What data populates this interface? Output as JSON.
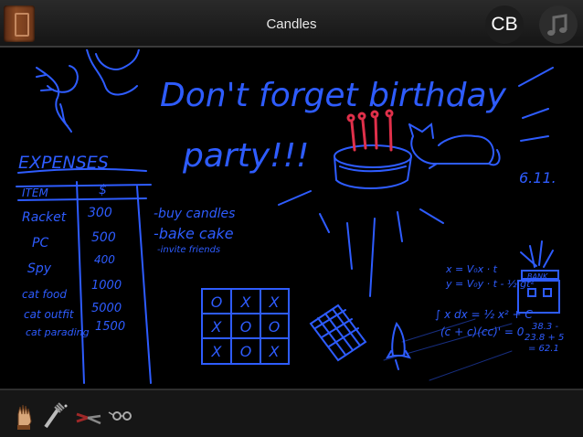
{
  "header": {
    "title": "Candles",
    "profile_initials": "CB"
  },
  "board": {
    "reminder_line1": "Don't forget birthday",
    "reminder_line2": "party!!!",
    "date": "6.11.",
    "todo": [
      "-buy candles",
      "-bake cake",
      "-invite friends"
    ],
    "expenses": {
      "title": "EXPENSES",
      "headers": [
        "ITEM",
        "$"
      ],
      "rows": [
        [
          "Racket",
          "300"
        ],
        [
          "PC",
          "500"
        ],
        [
          "Spy",
          "400"
        ],
        [
          "cat food",
          "1000"
        ],
        [
          "cat outfit",
          "5000"
        ],
        [
          "cat parading",
          "1500"
        ]
      ]
    },
    "tictactoe": [
      "O",
      "X",
      "X",
      "X",
      "O",
      "O",
      "X",
      "O",
      "X"
    ],
    "physics": {
      "line1": "x = V₀x · t",
      "line2": "y = V₀y · t - ½ gt²",
      "line3": "∫ x dx = ½ x² + C",
      "line4": "(c + c)(cc)' = 0"
    },
    "bank_label": "BANK",
    "sum": [
      "38.3 -",
      "23.8 + 5",
      "= 62.1"
    ]
  },
  "colors": {
    "chalk": "#2e5cff",
    "candle": "#e0304a"
  },
  "inventory": [
    {
      "name": "hand-icon"
    },
    {
      "name": "fork-icon"
    },
    {
      "name": "pliers-icon"
    },
    {
      "name": "glasses-icon"
    }
  ]
}
